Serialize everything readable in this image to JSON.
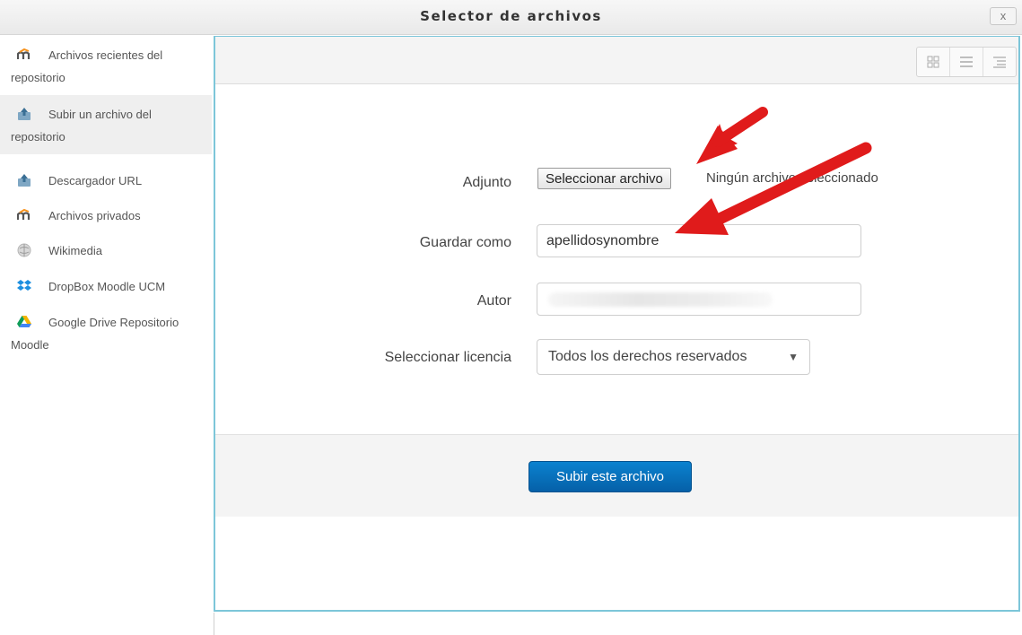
{
  "dialog": {
    "title": "Selector de archivos",
    "close_label": "x"
  },
  "sidebar": {
    "items": [
      {
        "label": "Archivos recientes del repositorio",
        "icon": "moodle-icon"
      },
      {
        "label": "Subir un archivo del repositorio",
        "icon": "upload-icon",
        "active": true
      },
      {
        "label": "Descargador URL",
        "icon": "url-download-icon"
      },
      {
        "label": "Archivos privados",
        "icon": "moodle-icon"
      },
      {
        "label": "Wikimedia",
        "icon": "wikimedia-icon"
      },
      {
        "label": "DropBox Moodle UCM",
        "icon": "dropbox-icon"
      },
      {
        "label": "Google Drive Repositorio Moodle",
        "icon": "google-drive-icon"
      }
    ]
  },
  "toolbar": {
    "view_icons": [
      "grid-view-icon",
      "list-view-icon",
      "tree-view-icon"
    ]
  },
  "form": {
    "attachment_label": "Adjunto",
    "choose_file_label": "Seleccionar archivo",
    "no_file_text": "Ningún archivo seleccionado",
    "save_as_label": "Guardar como",
    "save_as_value": "apellidosynombre",
    "author_label": "Autor",
    "author_value": "",
    "license_label": "Seleccionar licencia",
    "license_value": "Todos los derechos reservados",
    "upload_button": "Subir este archivo"
  },
  "colors": {
    "accent_border": "#7dc6d9",
    "primary_button": "#0a74c4",
    "arrow": "#e01b1b"
  }
}
